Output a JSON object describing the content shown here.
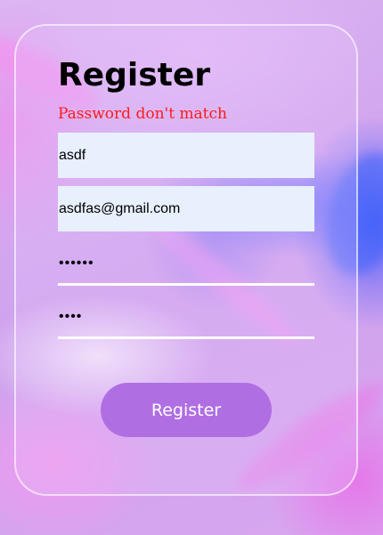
{
  "form": {
    "title": "Register",
    "error_message": "Password don't match",
    "name_field": {
      "value": "asdf"
    },
    "email_field": {
      "value": "asdfas@gmail.com"
    },
    "password_field": {
      "value": "••••••"
    },
    "confirm_password_field": {
      "value": "••••"
    },
    "submit_label": "Register"
  },
  "colors": {
    "error": "#ff1a1a",
    "button": "#b06ee3",
    "autofill_background": "#e8f0fe"
  }
}
